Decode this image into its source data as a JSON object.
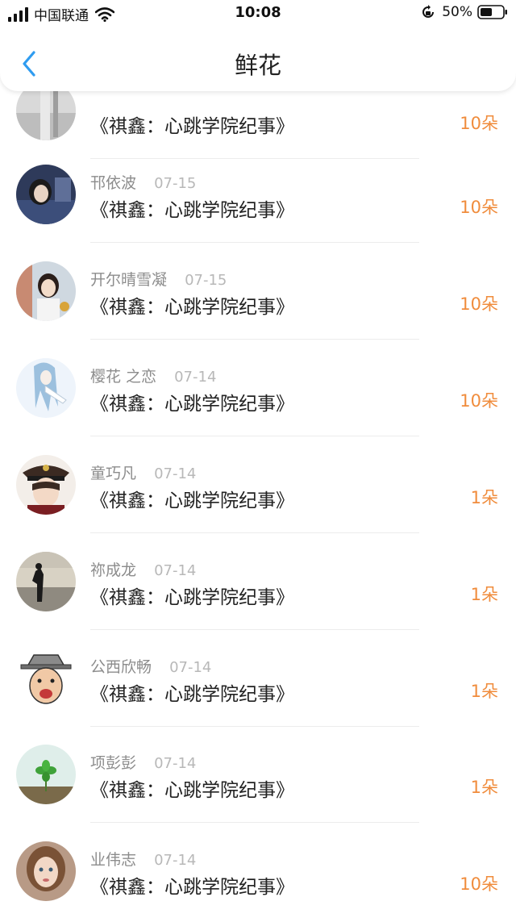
{
  "status_bar": {
    "carrier": "中国联通",
    "time": "10:08",
    "battery": "50%"
  },
  "nav": {
    "title": "鲜花"
  },
  "colors": {
    "accent_blue": "#2f9cf0",
    "count_orange": "#f08c3c"
  },
  "list": [
    {
      "name": "",
      "date": "",
      "title": "《祺鑫：心跳学院纪事》",
      "count": "10朵",
      "avatar": "photo-gray-wall"
    },
    {
      "name": "邗依波",
      "date": "07-15",
      "title": "《祺鑫：心跳学院纪事》",
      "count": "10朵",
      "avatar": "photo-girl-dark"
    },
    {
      "name": "开尔晴雪凝",
      "date": "07-15",
      "title": "《祺鑫：心跳学院纪事》",
      "count": "10朵",
      "avatar": "photo-girl-bright"
    },
    {
      "name": "樱花 之恋",
      "date": "07-14",
      "title": "《祺鑫：心跳学院纪事》",
      "count": "10朵",
      "avatar": "anime-blue-hair"
    },
    {
      "name": "童巧凡",
      "date": "07-14",
      "title": "《祺鑫：心跳学院纪事》",
      "count": "1朵",
      "avatar": "anime-captain-hat"
    },
    {
      "name": "祢成龙",
      "date": "07-14",
      "title": "《祺鑫：心跳学院纪事》",
      "count": "1朵",
      "avatar": "photo-silhouette-field"
    },
    {
      "name": "公西欣畅",
      "date": "07-14",
      "title": "《祺鑫：心跳学院纪事》",
      "count": "1朵",
      "avatar": "cartoon-old-man-hat"
    },
    {
      "name": "项彭彭",
      "date": "07-14",
      "title": "《祺鑫：心跳学院纪事》",
      "count": "1朵",
      "avatar": "photo-clover-sprout"
    },
    {
      "name": "业伟志",
      "date": "07-14",
      "title": "《祺鑫：心跳学院纪事》",
      "count": "10朵",
      "avatar": "photo-girl-portrait"
    }
  ]
}
